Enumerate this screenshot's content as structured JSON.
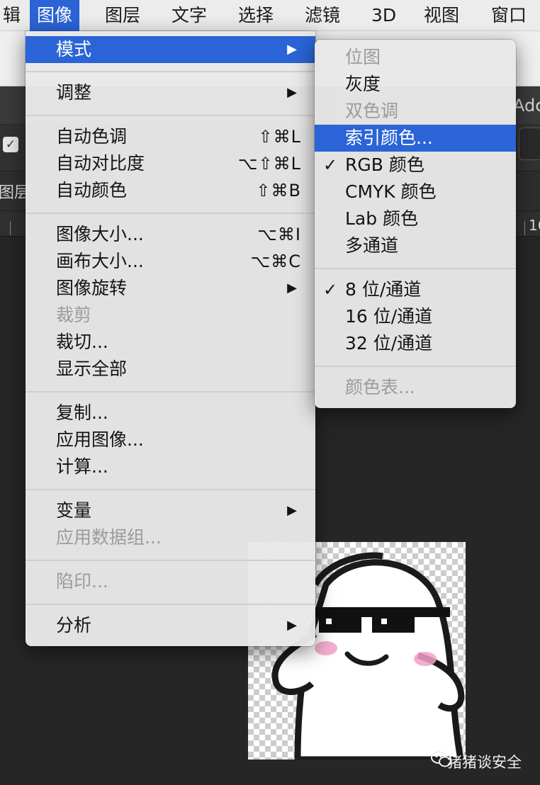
{
  "menubar": {
    "items": [
      {
        "label": "辑"
      },
      {
        "label": "图像"
      },
      {
        "label": "图层"
      },
      {
        "label": "文字"
      },
      {
        "label": "选择"
      },
      {
        "label": "滤镜"
      },
      {
        "label": "3D"
      },
      {
        "label": "视图"
      },
      {
        "label": "窗口"
      }
    ],
    "active_index": 1
  },
  "background": {
    "right_label": "Adc",
    "left_panel_label": "图层",
    "ruler_label": "16"
  },
  "image_menu": {
    "items": [
      {
        "label": "模式",
        "submenu": true,
        "highlighted": true
      },
      {
        "label": "调整",
        "submenu": true
      },
      {
        "label": "自动色调",
        "shortcut": "⇧⌘L"
      },
      {
        "label": "自动对比度",
        "shortcut": "⌥⇧⌘L"
      },
      {
        "label": "自动颜色",
        "shortcut": "⇧⌘B"
      },
      {
        "label": "图像大小...",
        "shortcut": "⌥⌘I"
      },
      {
        "label": "画布大小...",
        "shortcut": "⌥⌘C"
      },
      {
        "label": "图像旋转",
        "submenu": true
      },
      {
        "label": "裁剪",
        "disabled": true
      },
      {
        "label": "裁切..."
      },
      {
        "label": "显示全部"
      },
      {
        "label": "复制..."
      },
      {
        "label": "应用图像..."
      },
      {
        "label": "计算..."
      },
      {
        "label": "变量",
        "submenu": true
      },
      {
        "label": "应用数据组...",
        "disabled": true
      },
      {
        "label": "陷印...",
        "disabled": true
      },
      {
        "label": "分析",
        "submenu": true
      }
    ]
  },
  "mode_submenu": {
    "items": [
      {
        "label": "位图",
        "disabled": true
      },
      {
        "label": "灰度"
      },
      {
        "label": "双色调",
        "disabled": true
      },
      {
        "label": "索引颜色...",
        "highlighted": true
      },
      {
        "label": "RGB 颜色",
        "checked": true
      },
      {
        "label": "CMYK 颜色"
      },
      {
        "label": "Lab 颜色"
      },
      {
        "label": "多通道"
      },
      {
        "label": "8 位/通道",
        "checked": true
      },
      {
        "label": "16 位/通道"
      },
      {
        "label": "32 位/通道"
      },
      {
        "label": "颜色表...",
        "disabled": true
      }
    ]
  },
  "symbols": {
    "submenu_arrow": "▶",
    "checkmark": "✓",
    "checkbox": "✓"
  },
  "watermark": {
    "text": "猪猪谈安全",
    "icon": "wechat-icon"
  },
  "colors": {
    "highlight": "#2a64d6",
    "menu_bg": "#e8e8e8",
    "disabled_text": "#9b9b9b"
  }
}
